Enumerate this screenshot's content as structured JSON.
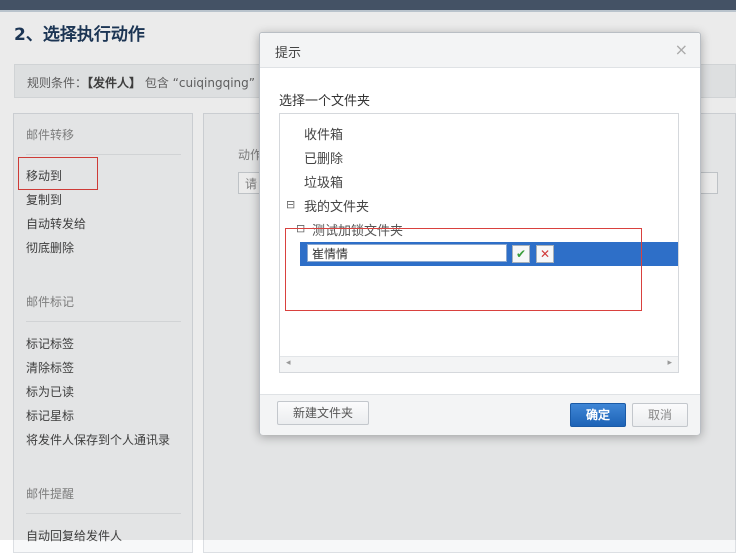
{
  "page": {
    "section_title": "2、选择执行动作",
    "rule_label": "规则条件：",
    "rule_sender": "【发件人】",
    "rule_rest": " 包含 “cuiqingqing”"
  },
  "sidebar": {
    "groups": [
      {
        "title": "邮件转移",
        "items": [
          "移动到",
          "复制到",
          "自动转发给",
          "彻底删除"
        ]
      },
      {
        "title": "邮件标记",
        "items": [
          "标记标签",
          "清除标签",
          "标为已读",
          "标记星标",
          "将发件人保存到个人通讯录"
        ]
      },
      {
        "title": "邮件提醒",
        "items": [
          "自动回复给发件人"
        ]
      }
    ]
  },
  "action_panel": {
    "label": "动作",
    "select_text": "请"
  },
  "dialog": {
    "title": "提示",
    "close": "×",
    "prompt": "选择一个文件夹",
    "folders": [
      "收件箱",
      "已删除",
      "垃圾箱",
      "我的文件夹",
      "测试加锁文件夹"
    ],
    "toggle_collapse": "⊟",
    "edit_value": "崔情情",
    "confirm_icon": "✔",
    "cancel_icon": "✕",
    "scroll_left": "◂",
    "scroll_right": "▸",
    "new_folder": "新建文件夹",
    "ok": "确定",
    "cancel": "取消"
  },
  "colors": {
    "accent": "#2e6fc8",
    "highlight_border": "#d9413e",
    "title": "#1f3a5c"
  }
}
